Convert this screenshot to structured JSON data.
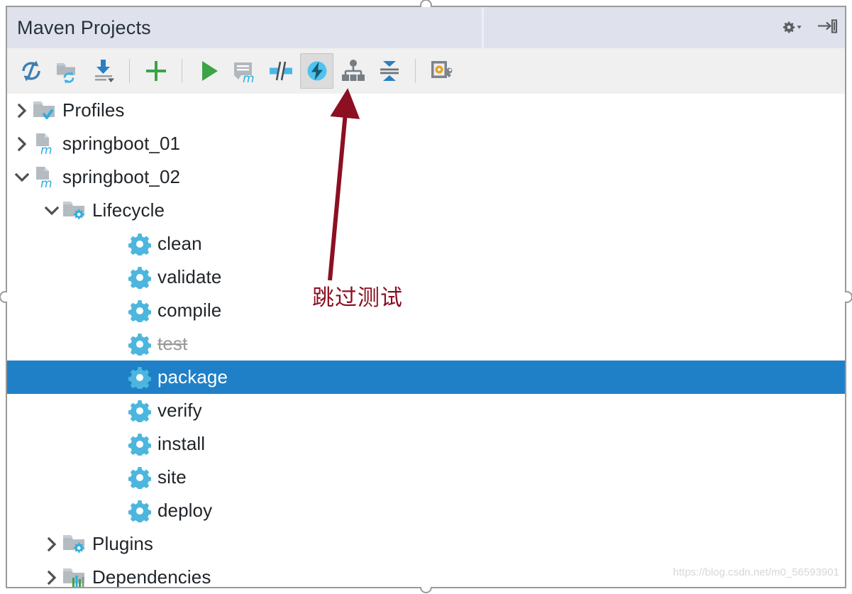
{
  "window": {
    "title": "Maven Projects"
  },
  "titlebar_actions": [
    {
      "name": "settings-gear-dropdown",
      "icon": "gear-dropdown-icon",
      "label": "Settings"
    },
    {
      "name": "hide-panel",
      "icon": "hide-panel-icon",
      "label": "Hide"
    }
  ],
  "toolbar": {
    "buttons": [
      {
        "name": "reimport-all-maven-projects",
        "icon": "reimport-icon",
        "label": "Reimport All Maven Projects",
        "active": false
      },
      {
        "name": "generate-sources-update-folders",
        "icon": "folder-sync-icon",
        "label": "Generate Sources and Update Folders",
        "active": false
      },
      {
        "name": "download-sources-documentation",
        "icon": "download-icon",
        "label": "Download Sources and/or Documentation",
        "active": false
      },
      {
        "name": "separator-1",
        "icon": "separator",
        "label": "",
        "active": false
      },
      {
        "name": "add-maven-project",
        "icon": "plus-icon",
        "label": "Add Maven Projects",
        "active": false
      },
      {
        "name": "separator-2",
        "icon": "separator",
        "label": "",
        "active": false
      },
      {
        "name": "run-maven-build",
        "icon": "run-icon",
        "label": "Run Maven Build",
        "active": false
      },
      {
        "name": "execute-maven-goal",
        "icon": "maven-goal-icon",
        "label": "Execute Maven Goal",
        "active": false
      },
      {
        "name": "toggle-offline-mode",
        "icon": "offline-icon",
        "label": "Toggle Offline Mode",
        "active": false
      },
      {
        "name": "toggle-skip-tests-mode",
        "icon": "skip-tests-icon",
        "label": "Toggle 'Skip Tests' Mode",
        "active": true
      },
      {
        "name": "show-dependencies",
        "icon": "dependency-graph-icon",
        "label": "Show Dependencies",
        "active": false
      },
      {
        "name": "collapse-all",
        "icon": "collapse-all-icon",
        "label": "Collapse All",
        "active": false
      },
      {
        "name": "separator-3",
        "icon": "separator",
        "label": "",
        "active": false
      },
      {
        "name": "maven-settings",
        "icon": "maven-settings-icon",
        "label": "Maven Settings",
        "active": false
      }
    ]
  },
  "tree": {
    "rows": [
      {
        "label": "Profiles",
        "level": 0,
        "chevron": "collapsed",
        "icon": "profiles-folder-icon",
        "state": "normal"
      },
      {
        "label": "springboot_01",
        "level": 0,
        "chevron": "collapsed",
        "icon": "maven-module-icon",
        "state": "normal"
      },
      {
        "label": "springboot_02",
        "level": 0,
        "chevron": "expanded",
        "icon": "maven-module-icon",
        "state": "normal"
      },
      {
        "label": "Lifecycle",
        "level": 1,
        "chevron": "expanded",
        "icon": "lifecycle-folder-icon",
        "state": "normal"
      },
      {
        "label": "clean",
        "level": 2,
        "chevron": "none",
        "icon": "goal-gear-icon",
        "state": "normal"
      },
      {
        "label": "validate",
        "level": 2,
        "chevron": "none",
        "icon": "goal-gear-icon",
        "state": "normal"
      },
      {
        "label": "compile",
        "level": 2,
        "chevron": "none",
        "icon": "goal-gear-icon",
        "state": "normal"
      },
      {
        "label": "test",
        "level": 2,
        "chevron": "none",
        "icon": "goal-gear-icon",
        "state": "skipped"
      },
      {
        "label": "package",
        "level": 2,
        "chevron": "none",
        "icon": "goal-gear-icon",
        "state": "selected"
      },
      {
        "label": "verify",
        "level": 2,
        "chevron": "none",
        "icon": "goal-gear-icon",
        "state": "normal"
      },
      {
        "label": "install",
        "level": 2,
        "chevron": "none",
        "icon": "goal-gear-icon",
        "state": "normal"
      },
      {
        "label": "site",
        "level": 2,
        "chevron": "none",
        "icon": "goal-gear-icon",
        "state": "normal"
      },
      {
        "label": "deploy",
        "level": 2,
        "chevron": "none",
        "icon": "goal-gear-icon",
        "state": "normal"
      },
      {
        "label": "Plugins",
        "level": 1,
        "chevron": "collapsed",
        "icon": "plugins-folder-icon",
        "state": "normal"
      },
      {
        "label": "Dependencies",
        "level": 1,
        "chevron": "collapsed",
        "icon": "dependencies-folder-icon",
        "state": "normal"
      }
    ]
  },
  "annotation": {
    "text": "跳过测试",
    "color": "#8c0f22",
    "arrow": "arrow-pointing-to-skip-tests-button"
  },
  "watermark": {
    "text": "https://blog.csdn.net/m0_56593901"
  },
  "colors": {
    "titlebar_bg": "#dfe2ec",
    "toolbar_bg": "#f0f0f0",
    "selection_blue": "#1f80c8",
    "gear_blue": "#4cb6de",
    "accent_green": "#3aa447",
    "annotation_red": "#8c0f22"
  }
}
